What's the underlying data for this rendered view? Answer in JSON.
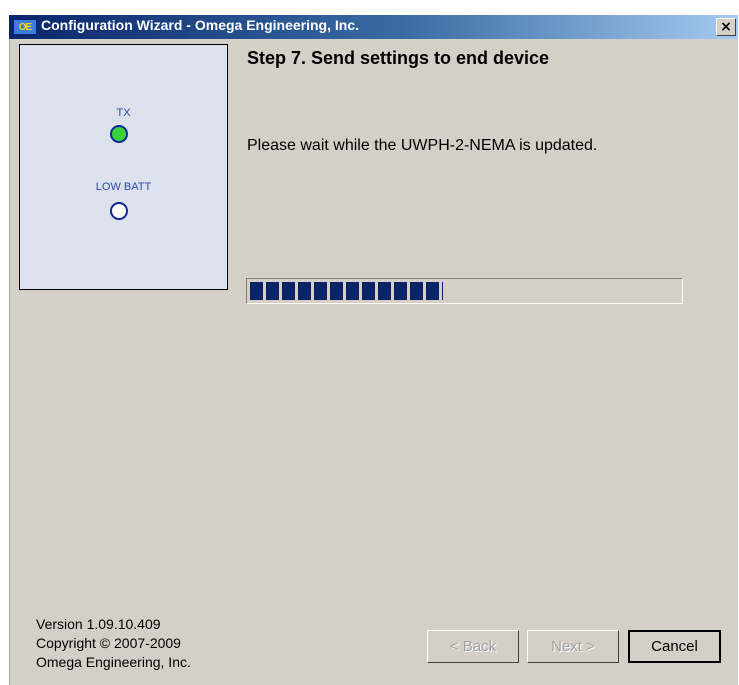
{
  "window": {
    "title": "Configuration Wizard - Omega Engineering, Inc.",
    "icon_text": "OE",
    "close_glyph": "×"
  },
  "led_panel": {
    "tx_label": "TX",
    "tx_color": "#3ad23a",
    "low_batt_label": "LOW BATT",
    "low_batt_color": "#ffffff"
  },
  "step": {
    "title": "Step 7.  Send settings to end device",
    "message": "Please wait while the UWPH-2-NEMA is updated.",
    "progress_fraction": 0.45
  },
  "footer": {
    "version": "Version 1.09.10.409",
    "copyright": "Copyright © 2007-2009",
    "company": "Omega Engineering, Inc."
  },
  "buttons": {
    "back": "< Back",
    "next": "Next >",
    "cancel": "Cancel"
  }
}
